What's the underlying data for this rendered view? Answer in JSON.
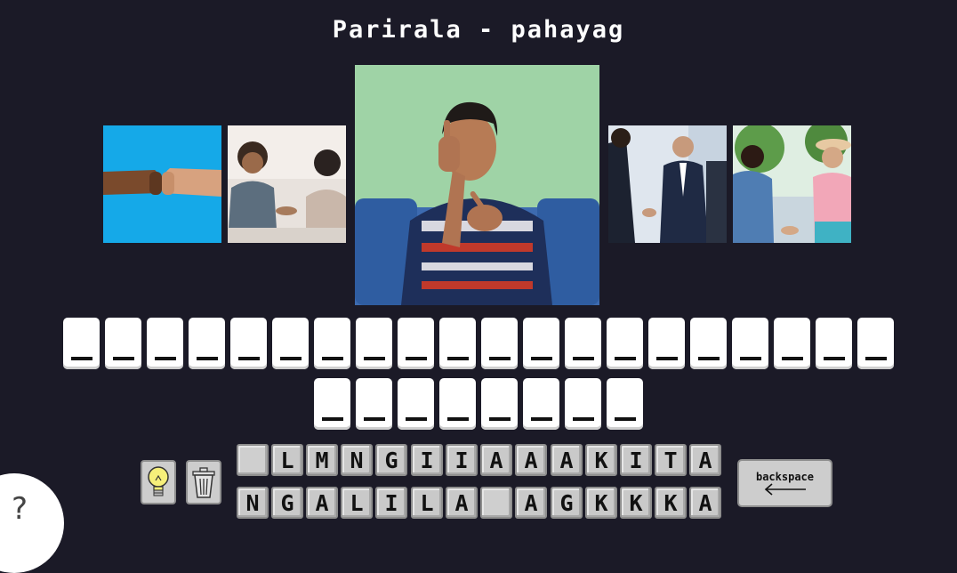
{
  "title": "Parirala - pahayag",
  "answer_slots_row1": [
    "_",
    "_",
    "_",
    "_",
    "_",
    "_",
    "_",
    "_",
    "_",
    "_",
    "_",
    "_",
    "_",
    "_",
    "_",
    "_",
    "_",
    "_",
    "_",
    "_"
  ],
  "answer_slots_row2": [
    "_",
    "_",
    "_",
    "_",
    "_",
    "_",
    "_",
    "_"
  ],
  "letter_tiles_row1": [
    "",
    "L",
    "M",
    "N",
    "G",
    "I",
    "I",
    "A",
    "A",
    "A",
    "K",
    "I",
    "T",
    "A"
  ],
  "letter_tiles_row2": [
    "N",
    "G",
    "A",
    "L",
    "I",
    "L",
    "A",
    "",
    "A",
    "G",
    "K",
    "K",
    "K",
    "A"
  ],
  "backspace_label": "backspace",
  "help_label": "?",
  "icons": {
    "hint": "lightbulb-icon",
    "clear": "trash-can-icon",
    "backspace": "left-arrow-icon",
    "help": "question-mark-icon"
  }
}
